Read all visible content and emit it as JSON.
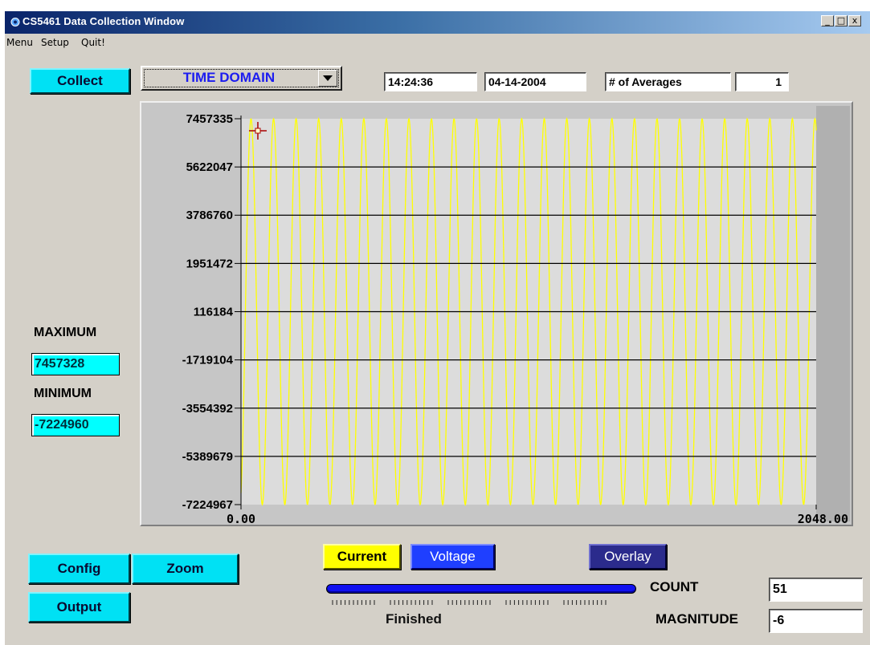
{
  "window": {
    "title": "CS5461 Data Collection Window",
    "controls": {
      "minimize": "_",
      "maximize": "□",
      "close": "x"
    }
  },
  "menubar": {
    "items": [
      "Menu",
      "Setup",
      "Quit!"
    ]
  },
  "toolbar": {
    "collect_label": "Collect",
    "domain_select": {
      "selected": "TIME DOMAIN"
    },
    "time": "14:24:36",
    "date": "04-14-2004",
    "averages_label": "# of Averages",
    "averages_value": "1"
  },
  "stats": {
    "maximum_label": "MAXIMUM",
    "maximum_value": "7457328",
    "minimum_label": "MINIMUM",
    "minimum_value": "-7224960"
  },
  "buttons": {
    "config": "Config",
    "zoom": "Zoom",
    "output": "Output",
    "current": "Current",
    "voltage": "Voltage",
    "overlay": "Overlay"
  },
  "status": {
    "text": "Finished",
    "progress": 1.0,
    "count_label": "COUNT",
    "count_value": "51",
    "magnitude_label": "MAGNITUDE",
    "magnitude_value": "-6"
  },
  "colors": {
    "plot_background": "#dcdcdc",
    "trace": "#ffff00",
    "button_cyan": "#00e1f4",
    "current_button": "#ffff00",
    "voltage_button": "#1f3fff",
    "overlay_button": "#2b2b8c"
  },
  "chart_data": {
    "type": "line",
    "title": "",
    "xlabel": "",
    "ylabel": "",
    "x_ticks": [
      "0.00",
      "2048.00"
    ],
    "xlim": [
      0,
      2048
    ],
    "y_ticks": [
      "7457335",
      "5622047",
      "3786760",
      "1951472",
      "116184",
      "-1719104",
      "-3554392",
      "-5389679",
      "-7224967"
    ],
    "ylim": [
      -7224967,
      7457335
    ],
    "grid": "horizontal",
    "series": [
      {
        "cycles": 25.5,
        "amplitude_max": 7457328,
        "amplitude_min": -7224960,
        "color": "#ffff00"
      }
    ],
    "cursor_marker": {
      "x": 60,
      "y": 7000000
    }
  }
}
